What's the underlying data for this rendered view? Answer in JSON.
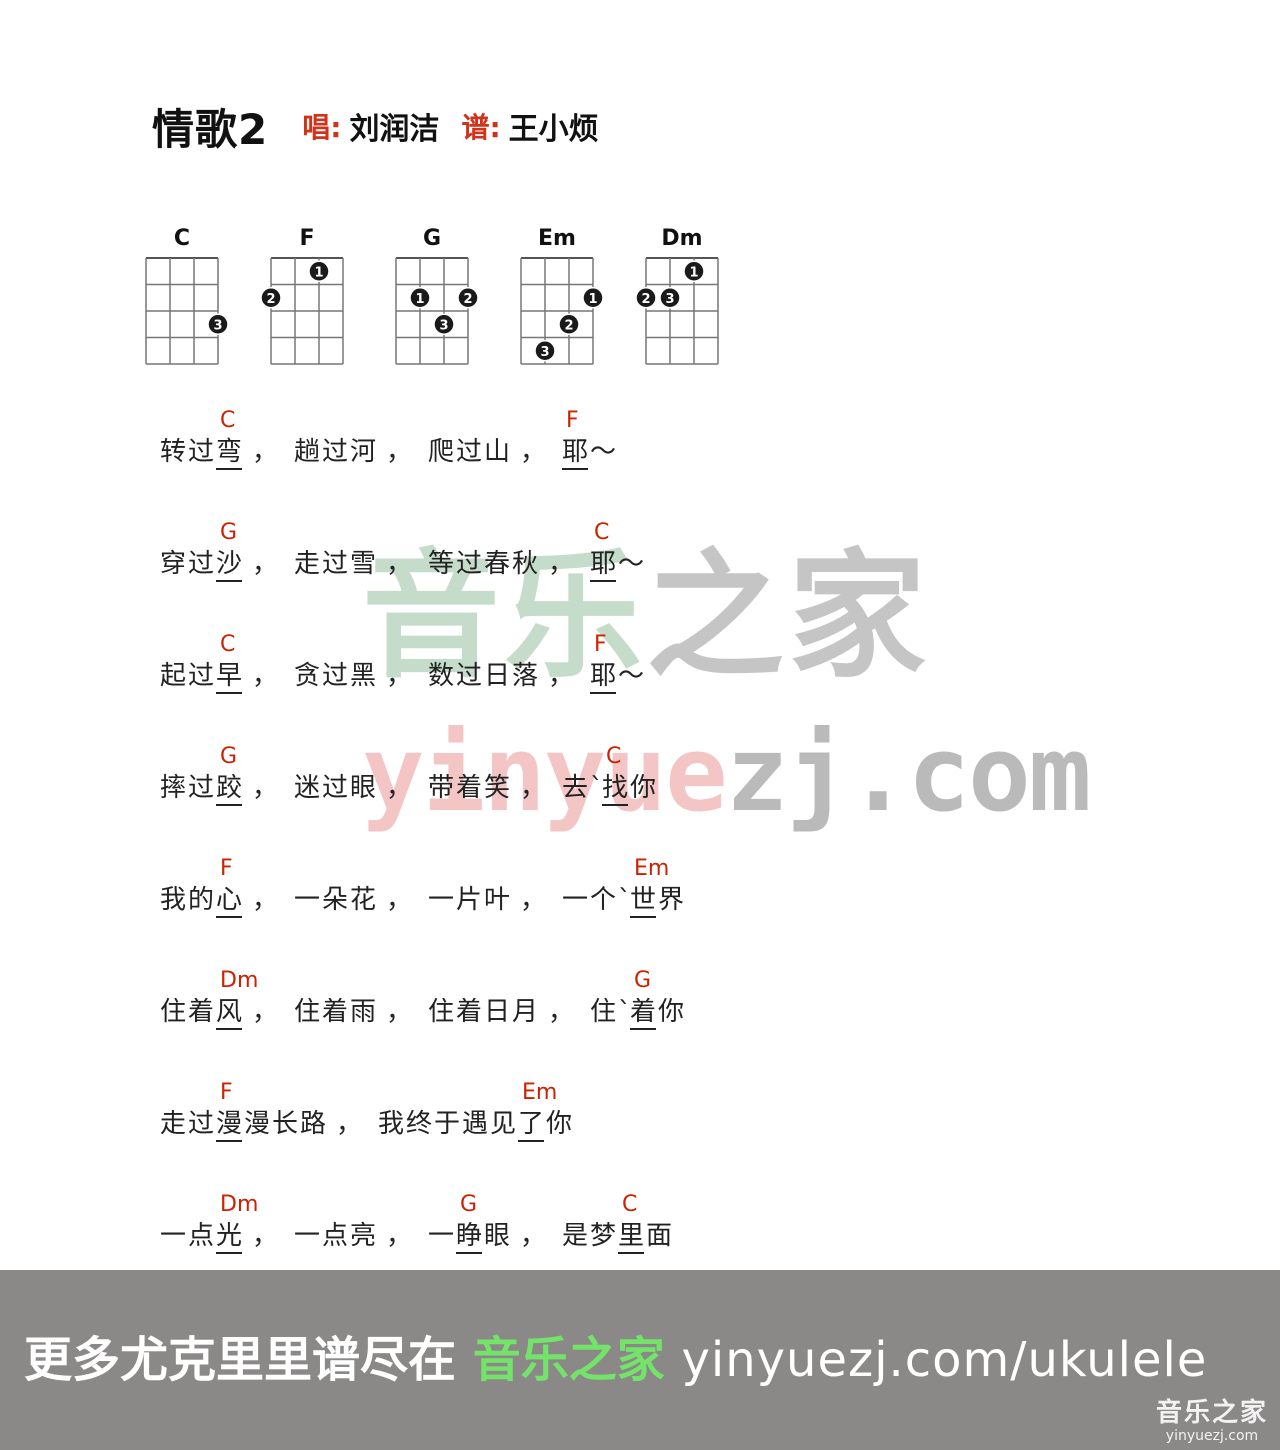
{
  "song": {
    "title": "情歌2",
    "singer_label": "唱:",
    "singer": "刘润洁",
    "arranger_label": "谱:",
    "arranger": "王小烦"
  },
  "chords": [
    {
      "name": "C",
      "dots": [
        {
          "string": 4,
          "fret": 3,
          "finger": "3"
        }
      ]
    },
    {
      "name": "F",
      "dots": [
        {
          "string": 3,
          "fret": 1,
          "finger": "1"
        },
        {
          "string": 1,
          "fret": 2,
          "finger": "2"
        }
      ]
    },
    {
      "name": "G",
      "dots": [
        {
          "string": 2,
          "fret": 2,
          "finger": "1"
        },
        {
          "string": 4,
          "fret": 2,
          "finger": "2"
        },
        {
          "string": 3,
          "fret": 3,
          "finger": "3"
        }
      ]
    },
    {
      "name": "Em",
      "dots": [
        {
          "string": 4,
          "fret": 2,
          "finger": "1"
        },
        {
          "string": 3,
          "fret": 3,
          "finger": "2"
        },
        {
          "string": 2,
          "fret": 4,
          "finger": "3"
        }
      ]
    },
    {
      "name": "Dm",
      "dots": [
        {
          "string": 3,
          "fret": 1,
          "finger": "1"
        },
        {
          "string": 1,
          "fret": 2,
          "finger": "2"
        },
        {
          "string": 2,
          "fret": 2,
          "finger": "3"
        }
      ]
    }
  ],
  "lyrics": [
    [
      [
        "转"
      ],
      [
        "过"
      ],
      [
        "弯",
        "C",
        1
      ],
      [
        "，"
      ],
      [
        "趟"
      ],
      [
        "过"
      ],
      [
        "河"
      ],
      [
        "，"
      ],
      [
        "爬"
      ],
      [
        "过"
      ],
      [
        "山"
      ],
      [
        "，"
      ],
      [
        "耶",
        "F",
        1
      ],
      [
        "～"
      ]
    ],
    [
      [
        "穿"
      ],
      [
        "过"
      ],
      [
        "沙",
        "G",
        1
      ],
      [
        "，"
      ],
      [
        "走"
      ],
      [
        "过"
      ],
      [
        "雪"
      ],
      [
        "，"
      ],
      [
        "等"
      ],
      [
        "过"
      ],
      [
        "春"
      ],
      [
        "秋"
      ],
      [
        "，"
      ],
      [
        "耶",
        "C",
        1
      ],
      [
        "～"
      ]
    ],
    [
      [
        "起"
      ],
      [
        "过"
      ],
      [
        "早",
        "C",
        1
      ],
      [
        "，"
      ],
      [
        "贪"
      ],
      [
        "过"
      ],
      [
        "黑"
      ],
      [
        "，"
      ],
      [
        "数"
      ],
      [
        "过"
      ],
      [
        "日"
      ],
      [
        "落"
      ],
      [
        "，"
      ],
      [
        "耶",
        "F",
        1
      ],
      [
        "～"
      ]
    ],
    [
      [
        "摔"
      ],
      [
        "过"
      ],
      [
        "跤",
        "G",
        1
      ],
      [
        "，"
      ],
      [
        "迷"
      ],
      [
        "过"
      ],
      [
        "眼"
      ],
      [
        "，"
      ],
      [
        "带"
      ],
      [
        "着"
      ],
      [
        "笑"
      ],
      [
        "，"
      ],
      [
        "去"
      ],
      [
        "`"
      ],
      [
        "找",
        "C",
        1
      ],
      [
        "你"
      ]
    ],
    [
      [
        "我"
      ],
      [
        "的"
      ],
      [
        "心",
        "F",
        1
      ],
      [
        "，"
      ],
      [
        "一"
      ],
      [
        "朵"
      ],
      [
        "花"
      ],
      [
        "，"
      ],
      [
        "一"
      ],
      [
        "片"
      ],
      [
        "叶"
      ],
      [
        "，"
      ],
      [
        "一"
      ],
      [
        "个"
      ],
      [
        "`"
      ],
      [
        "世",
        "Em",
        1
      ],
      [
        "界"
      ]
    ],
    [
      [
        "住"
      ],
      [
        "着"
      ],
      [
        "风",
        "Dm",
        1
      ],
      [
        "，"
      ],
      [
        "住"
      ],
      [
        "着"
      ],
      [
        "雨"
      ],
      [
        "，"
      ],
      [
        "住"
      ],
      [
        "着"
      ],
      [
        "日"
      ],
      [
        "月"
      ],
      [
        "，"
      ],
      [
        "住"
      ],
      [
        "`"
      ],
      [
        "着",
        "G",
        1
      ],
      [
        "你"
      ]
    ],
    [
      [
        "走"
      ],
      [
        "过"
      ],
      [
        "漫",
        "F",
        1
      ],
      [
        "漫"
      ],
      [
        "长"
      ],
      [
        "路"
      ],
      [
        "，"
      ],
      [
        "我"
      ],
      [
        "终"
      ],
      [
        "于"
      ],
      [
        "遇"
      ],
      [
        "见"
      ],
      [
        "了",
        "Em",
        1
      ],
      [
        "你"
      ]
    ],
    [
      [
        "一"
      ],
      [
        "点"
      ],
      [
        "光",
        "Dm",
        1
      ],
      [
        "，"
      ],
      [
        "一"
      ],
      [
        "点"
      ],
      [
        "亮"
      ],
      [
        "，"
      ],
      [
        "一"
      ],
      [
        "睁",
        "G",
        1
      ],
      [
        "眼"
      ],
      [
        "，"
      ],
      [
        "是"
      ],
      [
        "梦"
      ],
      [
        "里",
        "C",
        1
      ],
      [
        "面"
      ]
    ]
  ],
  "watermark": {
    "cn_a": "音乐",
    "cn_b": "之家",
    "url_a": "yinyue",
    "url_b": "zj.com"
  },
  "footer": {
    "text_white": "更多尤克里里谱尽在",
    "text_green": "音乐之家",
    "url": "yinyuezj.com/ukulele",
    "logo_cn": "音乐之家",
    "logo_url": "yinyuezj.com"
  }
}
